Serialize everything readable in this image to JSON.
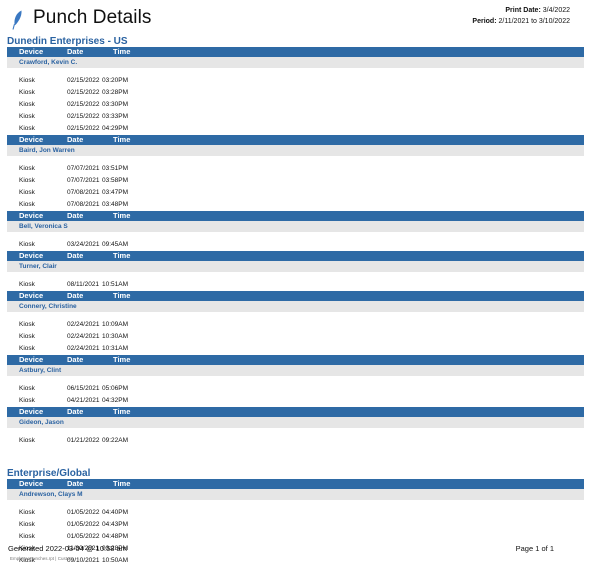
{
  "header": {
    "title": "Punch Details",
    "print_date_label": "Print Date:",
    "print_date_value": "3/4/2022",
    "period_label": "Period:",
    "period_value": "2/11/2021 to 3/10/2022",
    "logo_icon": "feather-icon",
    "logo_color": "#3a78c2"
  },
  "columns": {
    "device": "Device",
    "date": "Date",
    "time": "Time"
  },
  "colors": {
    "header_bar": "#2e6aa5",
    "accent_text": "#2a62a1",
    "employee_bar": "#e6e6e6"
  },
  "enterprises": [
    {
      "name": "Dunedin Enterprises - US",
      "employees": [
        {
          "name": "Crawford, Kevin C.",
          "punches": [
            {
              "device": "Kiosk",
              "date": "02/15/2022",
              "time": "03:20PM"
            },
            {
              "device": "Kiosk",
              "date": "02/15/2022",
              "time": "03:28PM"
            },
            {
              "device": "Kiosk",
              "date": "02/15/2022",
              "time": "03:30PM"
            },
            {
              "device": "Kiosk",
              "date": "02/15/2022",
              "time": "03:33PM"
            },
            {
              "device": "Kiosk",
              "date": "02/15/2022",
              "time": "04:29PM"
            }
          ]
        },
        {
          "name": "Baird, Jon Warren",
          "punches": [
            {
              "device": "Kiosk",
              "date": "07/07/2021",
              "time": "03:51PM"
            },
            {
              "device": "Kiosk",
              "date": "07/07/2021",
              "time": "03:58PM"
            },
            {
              "device": "Kiosk",
              "date": "07/08/2021",
              "time": "03:47PM"
            },
            {
              "device": "Kiosk",
              "date": "07/08/2021",
              "time": "03:48PM"
            }
          ]
        },
        {
          "name": "Bell, Veronica S",
          "punches": [
            {
              "device": "Kiosk",
              "date": "03/24/2021",
              "time": "09:45AM"
            }
          ]
        },
        {
          "name": "Turner, Clair",
          "punches": [
            {
              "device": "Kiosk",
              "date": "08/11/2021",
              "time": "10:51AM"
            }
          ]
        },
        {
          "name": "Connery, Christine",
          "punches": [
            {
              "device": "Kiosk",
              "date": "02/24/2021",
              "time": "10:09AM"
            },
            {
              "device": "Kiosk",
              "date": "02/24/2021",
              "time": "10:30AM"
            },
            {
              "device": "Kiosk",
              "date": "02/24/2021",
              "time": "10:31AM"
            }
          ]
        },
        {
          "name": "Astbury, Clint",
          "punches": [
            {
              "device": "Kiosk",
              "date": "06/15/2021",
              "time": "05:06PM"
            },
            {
              "device": "Kiosk",
              "date": "04/21/2021",
              "time": "04:32PM"
            }
          ]
        },
        {
          "name": "Gideon, Jason",
          "punches": [
            {
              "device": "Kiosk",
              "date": "01/21/2022",
              "time": "09:22AM"
            }
          ]
        }
      ]
    },
    {
      "name": "Enterprise/Global",
      "employees": [
        {
          "name": "Andrewson, Clays M",
          "punches": [
            {
              "device": "Kiosk",
              "date": "01/05/2022",
              "time": "04:40PM"
            },
            {
              "device": "Kiosk",
              "date": "01/05/2022",
              "time": "04:43PM"
            },
            {
              "device": "Kiosk",
              "date": "01/05/2022",
              "time": "04:48PM"
            },
            {
              "device": "Kiosk",
              "date": "11/30/2021",
              "time": "03:28PM"
            },
            {
              "device": "Kiosk",
              "date": "09/10/2021",
              "time": "10:50AM"
            }
          ]
        }
      ]
    }
  ],
  "footer": {
    "generated": "Generated 2022-03-04 @ 10:58 am",
    "page": "Page 1 of 1",
    "source": "EmployeePunches.rpt | Custom"
  }
}
